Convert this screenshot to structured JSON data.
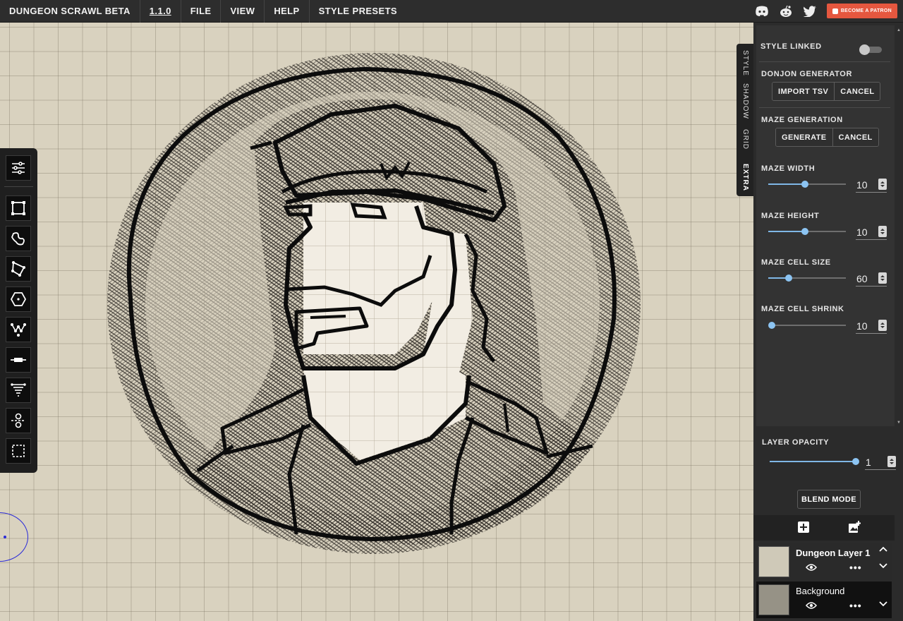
{
  "menu": {
    "app_title": "DUNGEON SCRAWL BETA",
    "version": "1.1.0",
    "file": "FILE",
    "view": "VIEW",
    "help": "HELP",
    "style_presets": "STYLE PRESETS"
  },
  "topbar_right": {
    "icons": [
      "discord-icon",
      "reddit-icon",
      "twitter-icon"
    ],
    "patron_label": "BECOME A PATRON",
    "patron_color": "#e5573f"
  },
  "side_tabs": [
    "STYLE",
    "SHADOW",
    "GRID",
    "EXTRA"
  ],
  "active_tab": "EXTRA",
  "extra_panel": {
    "style_linked": {
      "label": "STYLE LINKED",
      "enabled": false
    },
    "donjon": {
      "label": "DONJON GENERATOR",
      "import": "IMPORT TSV",
      "cancel": "CANCEL"
    },
    "maze": {
      "label": "MAZE GENERATION",
      "generate": "GENERATE",
      "cancel": "CANCEL"
    },
    "sliders": [
      {
        "label": "MAZE WIDTH",
        "value": "10",
        "fraction": 0.47
      },
      {
        "label": "MAZE HEIGHT",
        "value": "10",
        "fraction": 0.47
      },
      {
        "label": "MAZE CELL SIZE",
        "value": "60",
        "fraction": 0.26
      },
      {
        "label": "MAZE CELL SHRINK",
        "value": "10",
        "fraction": 0.0
      }
    ]
  },
  "layer_opacity": {
    "label": "LAYER OPACITY",
    "value": "1",
    "fraction": 1.0
  },
  "blend_mode": "BLEND MODE",
  "layers": [
    {
      "name": "Dungeon Layer 1",
      "active": true
    },
    {
      "name": "Background",
      "active": false
    }
  ],
  "accent_color": "#8cc4f2",
  "canvas_color": "#d9d2bf"
}
